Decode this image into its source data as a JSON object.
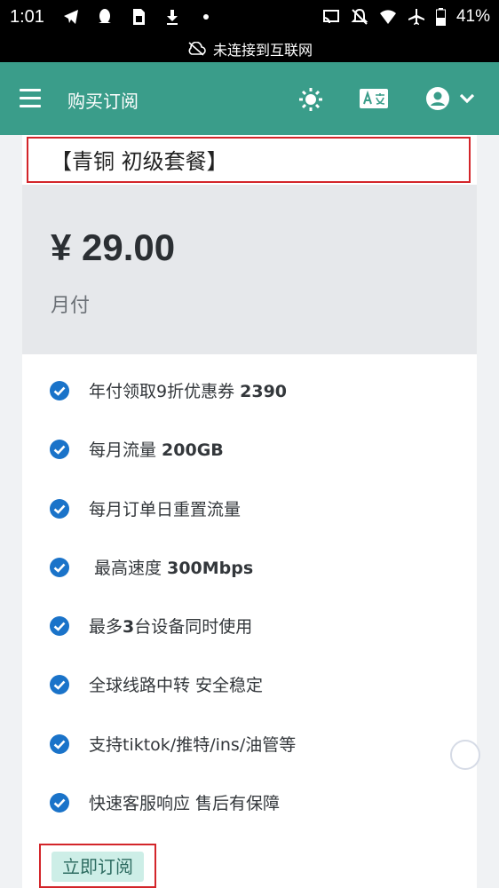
{
  "status_bar": {
    "time": "1:01",
    "battery_percent": "41%",
    "left_icons": [
      "telegram-icon",
      "qq-icon",
      "sim-icon",
      "download-icon",
      "dot-icon"
    ],
    "right_icons": [
      "cast-icon",
      "mute-icon",
      "wifi-icon",
      "airplane-icon",
      "battery-icon"
    ]
  },
  "offline_banner": {
    "text": "未连接到互联网",
    "icon": "cloud-off-icon"
  },
  "app_bar": {
    "title": "购买订阅",
    "background_color": "#3a9d8a",
    "icons": [
      "menu-icon",
      "brightness-icon",
      "translate-icon",
      "account-icon",
      "chevron-down-icon"
    ]
  },
  "plan": {
    "title": "【青铜 初级套餐】",
    "price": "¥ 29.00",
    "period": "月付",
    "features": [
      {
        "text": "年付领取9折优惠券 ",
        "bold": "2390"
      },
      {
        "text": "每月流量 ",
        "bold": "200GB"
      },
      {
        "text": "每月订单日重置流量",
        "bold": ""
      },
      {
        "text": " 最高速度 ",
        "bold": "300Mbps"
      },
      {
        "text": "最多",
        "bold": "3",
        "after": "台设备同时使用"
      },
      {
        "text": "全球线路中转 安全稳定",
        "bold": ""
      },
      {
        "text": "支持tiktok/推特/ins/油管等",
        "bold": ""
      },
      {
        "text": "快速客服响应 售后有保障",
        "bold": ""
      }
    ],
    "subscribe_label": "立即订阅",
    "check_color": "#1a73c9"
  }
}
